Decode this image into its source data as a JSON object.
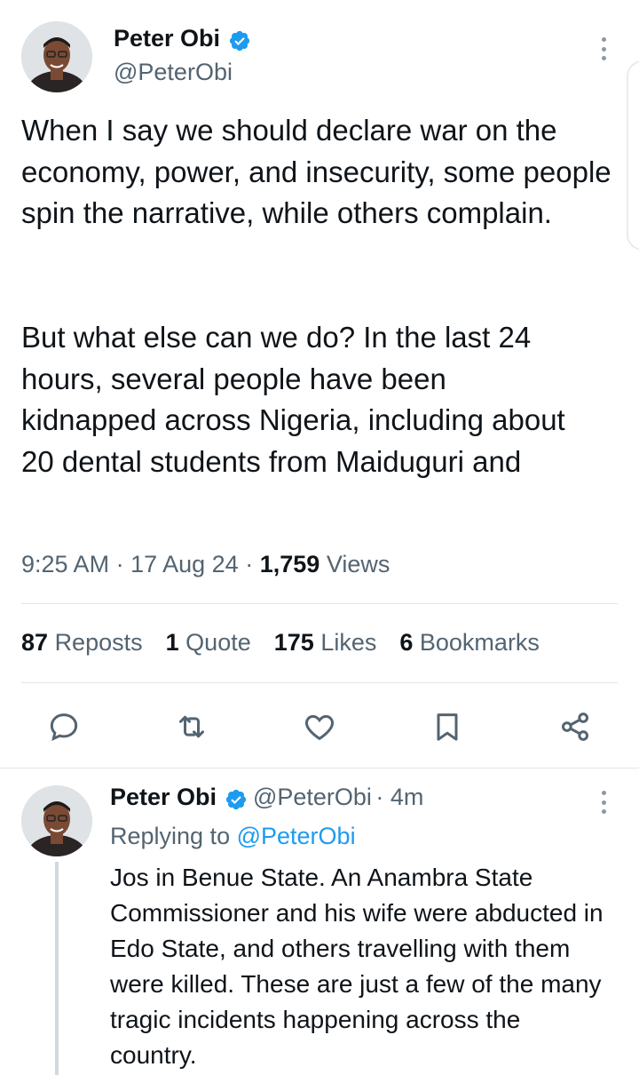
{
  "main_tweet": {
    "author_name": "Peter Obi",
    "author_handle": "@PeterObi",
    "text_paragraph_1": "When I say we should declare war on the economy, power, and insecurity, some people spin the narrative, while others complain.",
    "text_paragraph_2": "But what else can we do? In the last 24 hours, several people have been kidnapped across Nigeria, including about 20 dental students from Maiduguri and",
    "time": "9:25 AM",
    "date": "17 Aug 24",
    "views_count": "1,759",
    "views_label": "Views",
    "stats": [
      {
        "count": "87",
        "label": "Reposts"
      },
      {
        "count": "1",
        "label": "Quote"
      },
      {
        "count": "175",
        "label": "Likes"
      },
      {
        "count": "6",
        "label": "Bookmarks"
      }
    ],
    "actions": [
      "reply-icon",
      "repost-icon",
      "like-icon",
      "bookmark-icon",
      "share-icon"
    ]
  },
  "reply_tweet": {
    "author_name": "Peter Obi",
    "author_handle": "@PeterObi",
    "time_ago": "4m",
    "replying_to_label": "Replying to",
    "replying_to_handle": "@PeterObi",
    "text": "Jos in Benue State. An Anambra State Commissioner and his wife were abducted in Edo State, and others travelling with them were killed. These are just a few of the many tragic incidents happening across the country."
  },
  "colors": {
    "verified": "#1d9bf0",
    "secondary_text": "#536471",
    "link": "#1d9bf0",
    "divider": "#e1e6ea"
  }
}
